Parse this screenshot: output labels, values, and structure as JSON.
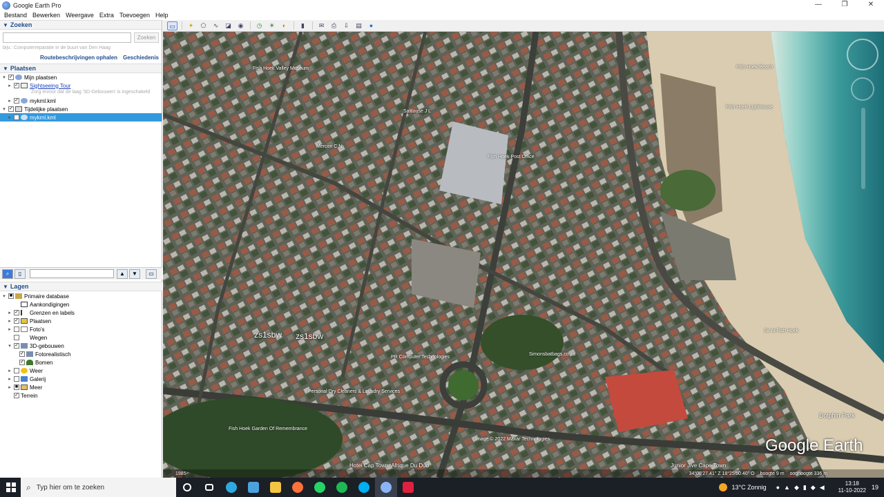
{
  "window": {
    "title": "Google Earth Pro",
    "controls": [
      "—",
      "❐",
      "✕"
    ]
  },
  "menu": [
    "Bestand",
    "Bewerken",
    "Weergave",
    "Extra",
    "Toevoegen",
    "Help"
  ],
  "search": {
    "header": "Zoeken",
    "button": "Zoeken",
    "hint": "bijv.: Computerreparatie in de buurt van Den Haag",
    "link_directions": "Routebeschrijvingen ophalen",
    "link_history": "Geschiedenis"
  },
  "places": {
    "header": "Plaatsen",
    "items": [
      {
        "label": "Mijn plaatsen"
      },
      {
        "label": "Sightseeing Tour"
      },
      {
        "label": "mykml.kml"
      },
      {
        "label": "Tijdelijke plaatsen"
      },
      {
        "label": "mykml.kml"
      }
    ],
    "note": "Zorg ervoor dat de laag '3D-Gebouwen' is ingeschakeld"
  },
  "layers": {
    "header": "Lagen",
    "items": [
      {
        "label": "Primaire database"
      },
      {
        "label": "Aankondigingen"
      },
      {
        "label": "Grenzen en labels"
      },
      {
        "label": "Plaatsen"
      },
      {
        "label": "Foto's"
      },
      {
        "label": "Wegen"
      },
      {
        "label": "3D-gebouwen"
      },
      {
        "label": "Fotorealistisch"
      },
      {
        "label": "Bomen"
      },
      {
        "label": "Weer"
      },
      {
        "label": "Galerij"
      },
      {
        "label": "Meer"
      },
      {
        "label": "Terrein"
      }
    ]
  },
  "map": {
    "labels": [
      "Fish Hoek Valley Museum",
      "Saltlouse J L",
      "Fish Hoek Beach",
      "Fish Hoek Lighthouse",
      "Fish Hoek Post Office",
      "Mercon C N",
      "Simonsbatbags.co.za",
      "Personal Dry Cleaners & Laundry Services",
      "Fish Hoek Garden Of Remembrance",
      "Hotel Cap Town, Afrique Du Dud",
      "Junior Jive Cape Town",
      "PR Computer Technologies",
      "Sir At Fish Hoek",
      "Dolphin Park"
    ],
    "big_labels": [
      "zs1sbw",
      "zs1sbw"
    ],
    "logo": "Google Earth",
    "imagery_credit": "Image © 2022 Maxar Technologies",
    "status": {
      "coords": "34°08'27.41\" Z  18°25'50.40\" O",
      "elev": "hoogte 9 m",
      "eye": "ooghoogte 336 m"
    },
    "year": "1985"
  },
  "taskbar": {
    "search_placeholder": "Typ hier om te zoeken",
    "weather": "13°C  Zonnig",
    "time": "13:18",
    "date": "11-10-2022",
    "notif": "19"
  }
}
